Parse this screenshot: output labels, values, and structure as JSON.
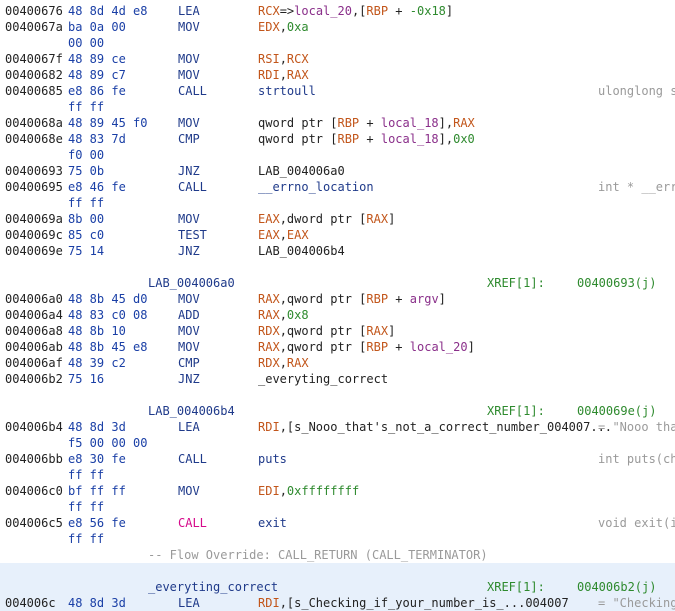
{
  "listing": {
    "rows": [
      {
        "addr": "00400676",
        "bytes": "48 8d 4d e8",
        "mnem": "LEA",
        "ops": [
          [
            "RCX",
            "reg"
          ],
          [
            "=>",
            ""
          ],
          [
            "local_20",
            "loc"
          ],
          [
            ",[",
            ""
          ],
          [
            "RBP",
            "reg"
          ],
          [
            " + ",
            ""
          ],
          [
            "-0x18",
            "num"
          ],
          [
            "]",
            ""
          ]
        ]
      },
      {
        "addr": "0040067a",
        "bytes": "ba 0a 00",
        "mnem": "MOV",
        "ops": [
          [
            "EDX",
            "reg"
          ],
          [
            ",",
            ""
          ],
          [
            "0xa",
            "num"
          ]
        ]
      },
      {
        "addr": "",
        "bytes": "00 00"
      },
      {
        "addr": "0040067f",
        "bytes": "48 89 ce",
        "mnem": "MOV",
        "ops": [
          [
            "RSI",
            "reg"
          ],
          [
            ",",
            ""
          ],
          [
            "RCX",
            "reg"
          ]
        ]
      },
      {
        "addr": "00400682",
        "bytes": "48 89 c7",
        "mnem": "MOV",
        "ops": [
          [
            "RDI",
            "reg"
          ],
          [
            ",",
            ""
          ],
          [
            "RAX",
            "reg"
          ]
        ]
      },
      {
        "addr": "00400685",
        "bytes": "e8 86 fe",
        "mnem": "CALL",
        "ops": [
          [
            "strtoull",
            "sym"
          ]
        ],
        "cmt": "ulonglong s"
      },
      {
        "addr": "",
        "bytes": "ff ff"
      },
      {
        "addr": "0040068a",
        "bytes": "48 89 45 f0",
        "mnem": "MOV",
        "ops": [
          [
            "qword ptr [",
            ""
          ],
          [
            "RBP",
            "reg"
          ],
          [
            " + ",
            ""
          ],
          [
            "local_18",
            "loc"
          ],
          [
            "],",
            ""
          ],
          [
            "RAX",
            "reg"
          ]
        ]
      },
      {
        "addr": "0040068e",
        "bytes": "48 83 7d",
        "mnem": "CMP",
        "ops": [
          [
            "qword ptr [",
            ""
          ],
          [
            "RBP",
            "reg"
          ],
          [
            " + ",
            ""
          ],
          [
            "local_18",
            "loc"
          ],
          [
            "],",
            ""
          ],
          [
            "0x0",
            "num"
          ]
        ]
      },
      {
        "addr": "",
        "bytes": "f0 00"
      },
      {
        "addr": "00400693",
        "bytes": "75 0b",
        "mnem": "JNZ",
        "ops": [
          [
            "LAB_004006a0",
            ""
          ]
        ]
      },
      {
        "addr": "00400695",
        "bytes": "e8 46 fe",
        "mnem": "CALL",
        "ops": [
          [
            "__errno_location",
            "sym"
          ]
        ],
        "cmt": "int * __err"
      },
      {
        "addr": "",
        "bytes": "ff ff"
      },
      {
        "addr": "0040069a",
        "bytes": "8b 00",
        "mnem": "MOV",
        "ops": [
          [
            "EAX",
            "reg"
          ],
          [
            ",dword ptr [",
            ""
          ],
          [
            "RAX",
            "reg"
          ],
          [
            "]",
            ""
          ]
        ]
      },
      {
        "addr": "0040069c",
        "bytes": "85 c0",
        "mnem": "TEST",
        "ops": [
          [
            "EAX",
            "reg"
          ],
          [
            ",",
            ""
          ],
          [
            "EAX",
            "reg"
          ]
        ]
      },
      {
        "addr": "0040069e",
        "bytes": "75 14",
        "mnem": "JNZ",
        "ops": [
          [
            "LAB_004006b4",
            ""
          ]
        ]
      },
      {
        "blank": true
      },
      {
        "label": "LAB_004006a0",
        "xref": "XREF[1]:",
        "xrefaddr": "00400693(j)"
      },
      {
        "addr": "004006a0",
        "bytes": "48 8b 45 d0",
        "mnem": "MOV",
        "ops": [
          [
            "RAX",
            "reg"
          ],
          [
            ",qword ptr [",
            ""
          ],
          [
            "RBP",
            "reg"
          ],
          [
            " + ",
            ""
          ],
          [
            "argv",
            "loc"
          ],
          [
            "]",
            ""
          ]
        ]
      },
      {
        "addr": "004006a4",
        "bytes": "48 83 c0 08",
        "mnem": "ADD",
        "ops": [
          [
            "RAX",
            "reg"
          ],
          [
            ",",
            ""
          ],
          [
            "0x8",
            "num"
          ]
        ]
      },
      {
        "addr": "004006a8",
        "bytes": "48 8b 10",
        "mnem": "MOV",
        "ops": [
          [
            "RDX",
            "reg"
          ],
          [
            ",qword ptr [",
            ""
          ],
          [
            "RAX",
            "reg"
          ],
          [
            "]",
            ""
          ]
        ]
      },
      {
        "addr": "004006ab",
        "bytes": "48 8b 45 e8",
        "mnem": "MOV",
        "ops": [
          [
            "RAX",
            "reg"
          ],
          [
            ",qword ptr [",
            ""
          ],
          [
            "RBP",
            "reg"
          ],
          [
            " + ",
            ""
          ],
          [
            "local_20",
            "loc"
          ],
          [
            "]",
            ""
          ]
        ]
      },
      {
        "addr": "004006af",
        "bytes": "48 39 c2",
        "mnem": "CMP",
        "ops": [
          [
            "RDX",
            "reg"
          ],
          [
            ",",
            ""
          ],
          [
            "RAX",
            "reg"
          ]
        ]
      },
      {
        "addr": "004006b2",
        "bytes": "75 16",
        "mnem": "JNZ",
        "ops": [
          [
            "_everyting_correct",
            ""
          ]
        ]
      },
      {
        "blank": true
      },
      {
        "label": "LAB_004006b4",
        "xref": "XREF[1]:",
        "xrefaddr": "0040069e(j)"
      },
      {
        "addr": "004006b4",
        "bytes": "48 8d 3d",
        "mnem": "LEA",
        "ops": [
          [
            "RDI",
            "reg"
          ],
          [
            ",[s_Nooo_that's_not_a_correct_number_004007...",
            ""
          ]
        ],
        "cmt": "= \"Nooo tha"
      },
      {
        "addr": "",
        "bytes": "f5 00 00 00"
      },
      {
        "addr": "004006bb",
        "bytes": "e8 30 fe",
        "mnem": "CALL",
        "ops": [
          [
            "puts",
            "sym"
          ]
        ],
        "cmt": "int puts(ch"
      },
      {
        "addr": "",
        "bytes": "ff ff"
      },
      {
        "addr": "004006c0",
        "bytes": "bf ff ff",
        "mnem": "MOV",
        "ops": [
          [
            "EDI",
            "reg"
          ],
          [
            ",",
            ""
          ],
          [
            "0xffffffff",
            "num"
          ]
        ]
      },
      {
        "addr": "",
        "bytes": "ff ff"
      },
      {
        "addr": "004006c5",
        "bytes": "e8 56 fe",
        "mnem": "CALL",
        "mnemRed": true,
        "ops": [
          [
            "exit",
            "sym"
          ]
        ],
        "cmt": "void exit(i"
      },
      {
        "addr": "",
        "bytes": "ff ff"
      },
      {
        "override": "-- Flow Override: CALL_RETURN (CALL_TERMINATOR)"
      },
      {
        "blank": true,
        "hl": true
      },
      {
        "label": "_everyting_correct",
        "xref": "XREF[1]:",
        "xrefaddr": "004006b2(j)",
        "hl": true
      },
      {
        "addr": "004006c",
        "bytes": "48 8d 3d",
        "mnem": "LEA",
        "ops": [
          [
            "RDI",
            "reg"
          ],
          [
            ",[s_Checking_if_your_number_is_...004007",
            ""
          ]
        ],
        "cmt": "= \"Checking",
        "hl": true
      }
    ]
  },
  "colors": {
    "background": "#ffffff",
    "highlight_row": "#e7f0fb",
    "mnemonic": "#1f3a8a",
    "register": "#c2561b",
    "local": "#8a2f8a",
    "number": "#2e8a2e",
    "comment": "#9a9a9a",
    "bytes": "#1a3fa6",
    "call_highlight": "#d60a8b"
  }
}
